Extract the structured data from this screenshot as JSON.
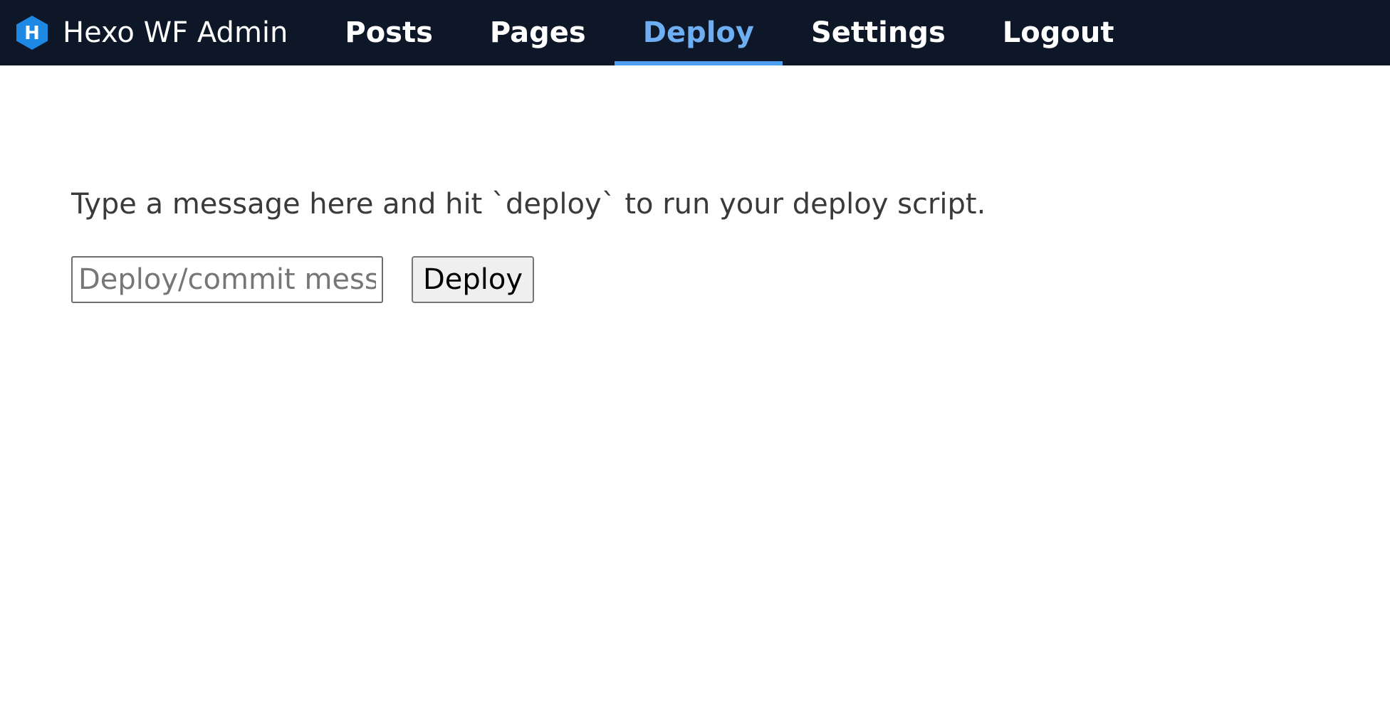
{
  "app": {
    "brand_text": "Hexo WF Admin",
    "logo_letter": "H",
    "logo_icon": "hexo-hexagon-logo-icon",
    "logo_color": "#1e88e5"
  },
  "nav": {
    "items": [
      {
        "label": "Posts",
        "active": false
      },
      {
        "label": "Pages",
        "active": false
      },
      {
        "label": "Deploy",
        "active": true
      },
      {
        "label": "Settings",
        "active": false
      },
      {
        "label": "Logout",
        "active": false
      }
    ]
  },
  "colors": {
    "navbar_bg": "#0d1727",
    "active_tab": "#6eaef2",
    "active_underline": "#4f9ff1"
  },
  "deploy": {
    "instructions": "Type a message here and hit `deploy` to run your deploy script.",
    "message_value": "",
    "message_placeholder": "Deploy/commit message",
    "button_label": "Deploy"
  }
}
